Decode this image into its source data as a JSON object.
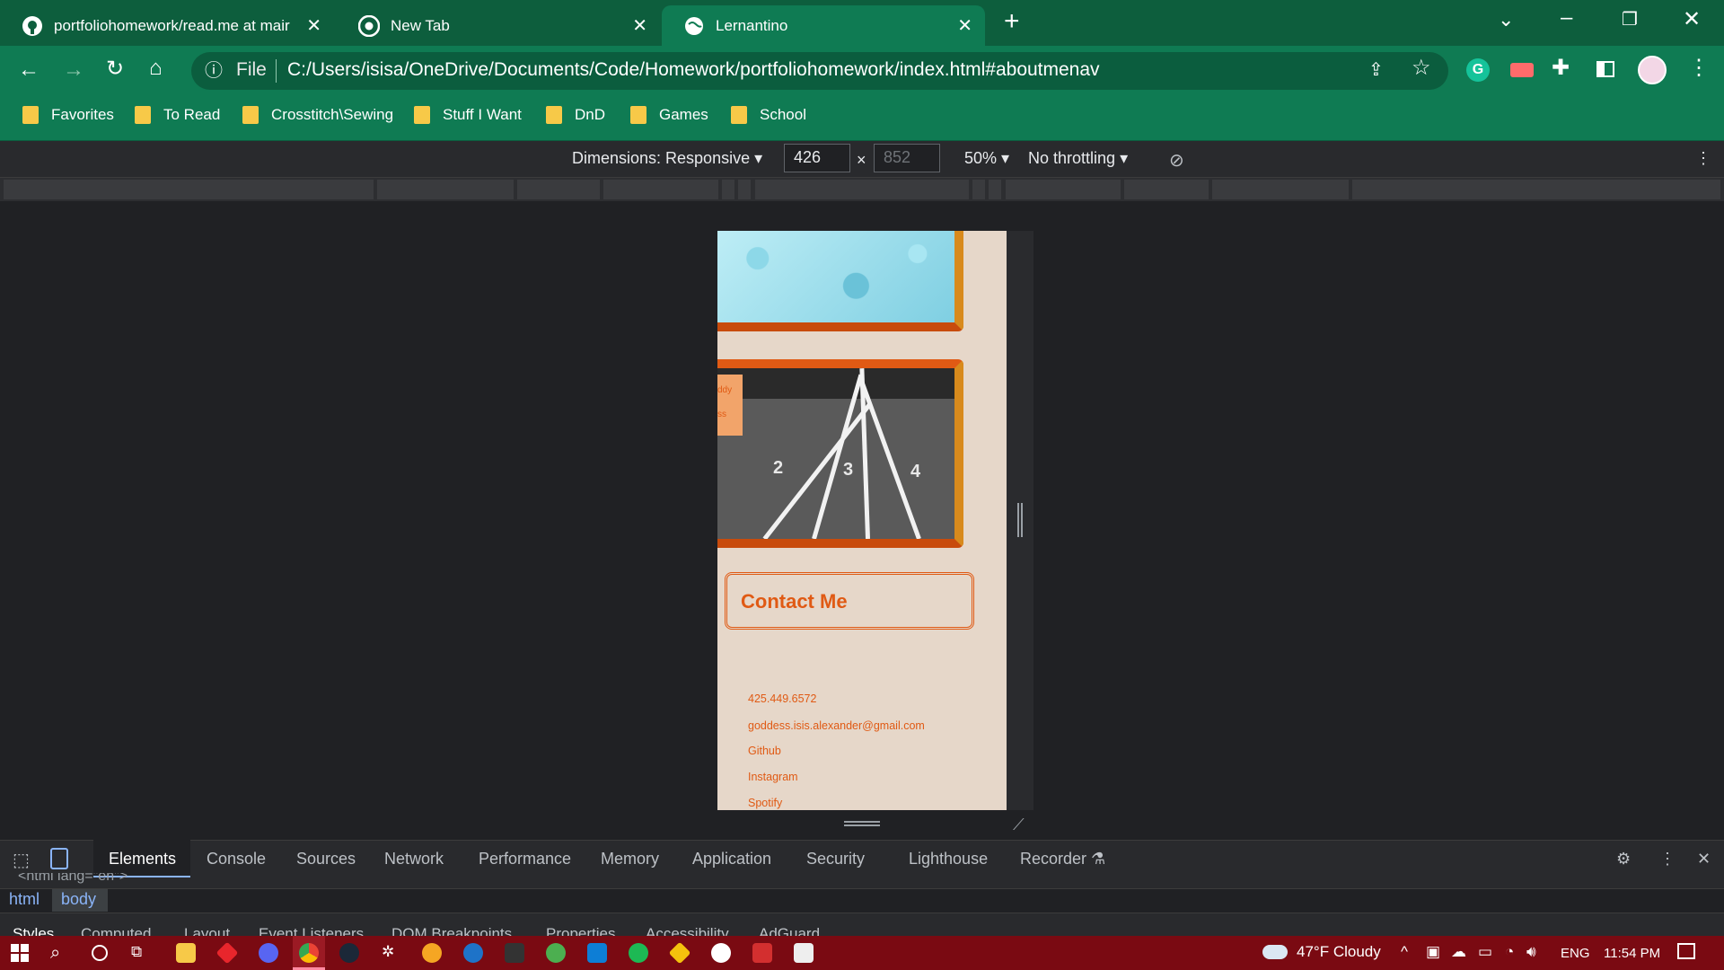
{
  "browser": {
    "tabs": [
      {
        "title": "portfoliohomework/read.me at mair",
        "icon": "github-icon",
        "active": false
      },
      {
        "title": "New Tab",
        "icon": "chrome-icon",
        "active": false
      },
      {
        "title": "Lernantino",
        "icon": "globe-icon",
        "active": true
      }
    ],
    "address": {
      "scheme_label": "File",
      "url": "C:/Users/isisa/OneDrive/Documents/Code/Homework/portfoliohomework/index.html#aboutmenav"
    },
    "bookmarks": [
      "Favorites",
      "To Read",
      "Crosstitch\\Sewing",
      "Stuff I Want",
      "DnD",
      "Games",
      "School"
    ]
  },
  "device_toolbar": {
    "dimensions_label": "Dimensions: Responsive",
    "width": "426",
    "height_placeholder": "852",
    "zoom": "50%",
    "throttling": "No throttling"
  },
  "page": {
    "partial_caption_1": "ddy",
    "partial_caption_2": "ss",
    "track_numbers": [
      "2",
      "3",
      "4"
    ],
    "contact_title": "Contact Me",
    "links": [
      "425.449.6572",
      "goddess.isis.alexander@gmail.com",
      "Github",
      "Instagram",
      "Spotify"
    ]
  },
  "devtools": {
    "tabs": [
      "Elements",
      "Console",
      "Sources",
      "Network",
      "Performance",
      "Memory",
      "Application",
      "Security",
      "Lighthouse",
      "Recorder"
    ],
    "selected_tab": "Elements",
    "code_snippet": "<html lang=\"en\">",
    "breadcrumbs": [
      "html",
      "body"
    ],
    "subtabs": [
      "Styles",
      "Computed",
      "Layout",
      "Event Listeners",
      "DOM Breakpoints",
      "Properties",
      "Accessibility",
      "AdGuard"
    ]
  },
  "taskbar": {
    "weather": "47°F  Cloudy",
    "language": "ENG",
    "time": "11:54 PM"
  },
  "colors": {
    "tabstrip": "#0d5e3d",
    "toolbar": "#0f7b53",
    "accent_orange": "#e05a14",
    "page_bg": "#e6d7c9",
    "taskbar": "#7a0a12"
  }
}
